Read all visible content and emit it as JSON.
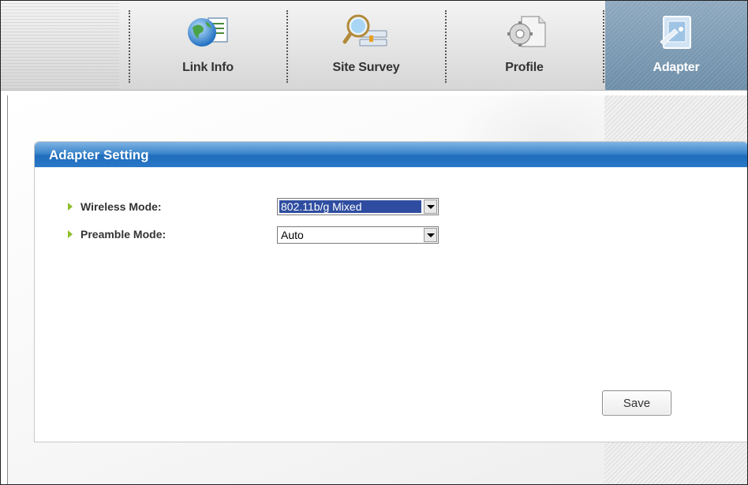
{
  "tabs": [
    {
      "label": "Link Info",
      "icon": "globe-document-icon"
    },
    {
      "label": "Site Survey",
      "icon": "magnifier-network-icon"
    },
    {
      "label": "Profile",
      "icon": "gear-document-icon"
    },
    {
      "label": "Adapter",
      "icon": "adapter-card-icon",
      "active": true
    }
  ],
  "panel": {
    "title": "Adapter Setting",
    "wireless_mode": {
      "label": "Wireless Mode:",
      "value": "802.11b/g  Mixed"
    },
    "preamble_mode": {
      "label": "Preamble Mode:",
      "value": "Auto"
    },
    "save_label": "Save"
  },
  "colors": {
    "accent_blue": "#2a78c8",
    "active_tab": "#7b98b2",
    "bullet_green": "#8fbf2a"
  }
}
